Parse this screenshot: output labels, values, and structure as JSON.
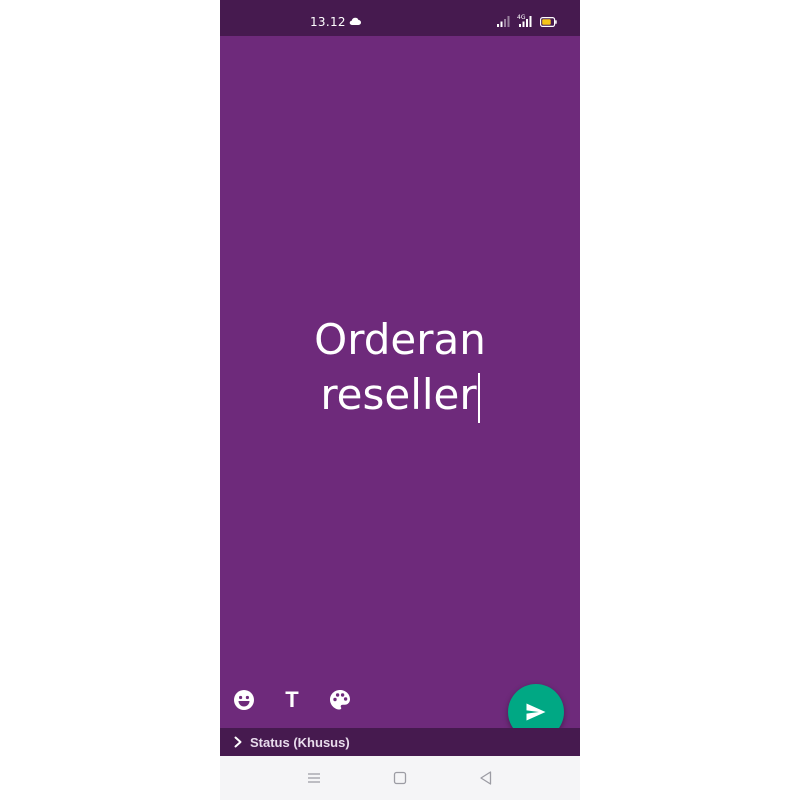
{
  "status_bar": {
    "time": "13.12",
    "network_label": "4G",
    "icons": [
      "cloud-icon",
      "signal-icon",
      "signal-icon",
      "battery-icon"
    ]
  },
  "composer": {
    "text_line_1": "Orderan",
    "text_line_2": "reseller",
    "background_color": "#6e2a7b"
  },
  "toolbar": {
    "tools": [
      "emoji-icon",
      "text-style-icon",
      "palette-icon"
    ],
    "text_tool_glyph": "T"
  },
  "send_button": {
    "icon": "send-icon",
    "color": "#00a884"
  },
  "audience": {
    "label": "Status (Khusus)"
  },
  "navigation": {
    "buttons": [
      "menu-icon",
      "home-icon",
      "back-icon"
    ]
  }
}
